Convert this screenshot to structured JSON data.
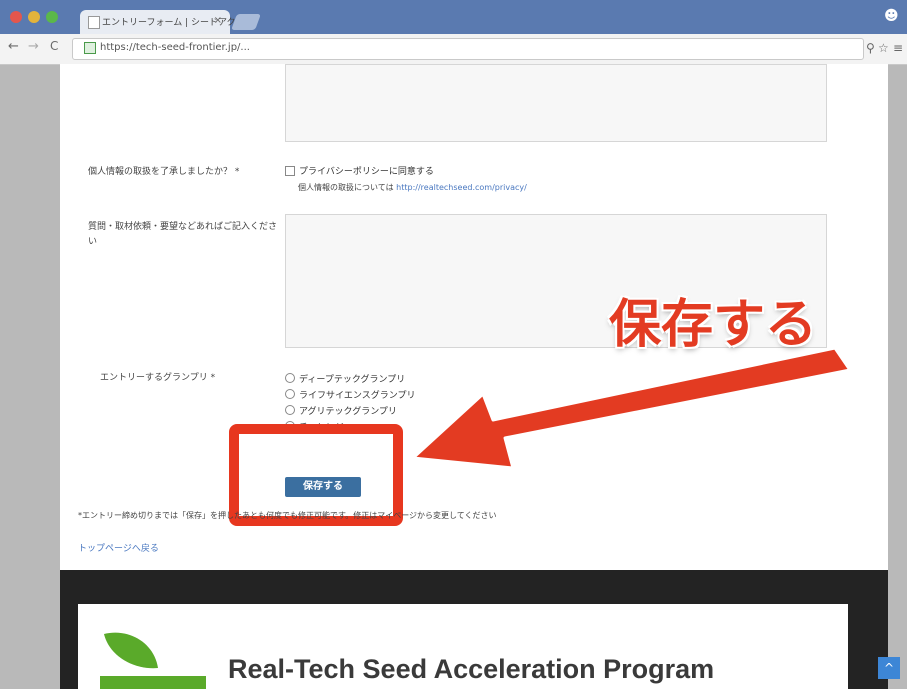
{
  "browser": {
    "tab_title": "エントリーフォーム | シードアク",
    "tab_close": "×",
    "url": "https://tech-seed-frontier.jp/...",
    "nav_back": "←",
    "nav_forward": "→",
    "nav_reload": "C"
  },
  "form": {
    "privacy_label": "個人情報の取扱を了承しましたか？ *",
    "privacy_checkbox": "プライバシーポリシーに同意する",
    "privacy_note": "個人情報の取扱については",
    "privacy_link": "http://realtechseed.com/privacy/",
    "notes_label": "質問・取材依頼・要望などあればご記入ください",
    "grandprix_label": "エントリーするグランプリ *",
    "grandprix_options": [
      "ディープテックグランプリ",
      "ライフサイエンスグランプリ",
      "アグリテックグランプリ",
      "チャレンジ"
    ],
    "save_button": "保存する",
    "footnote": "*エントリー締め切りまでは「保存」を押したあとも何度でも修正可能です。修正はマイページから変更してください",
    "toppage_link": "トップページへ戻る"
  },
  "footer": {
    "program_title": "Real-Tech Seed Acceleration Program"
  },
  "annotation": {
    "callout": "保存する",
    "color": "#e33b22"
  }
}
